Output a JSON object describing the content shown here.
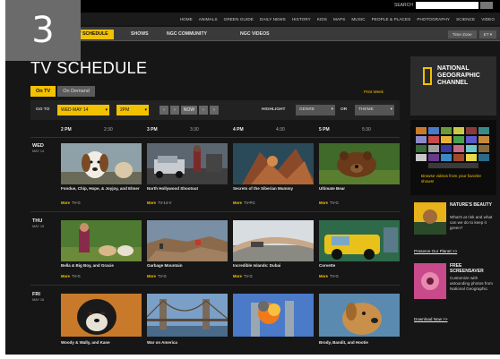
{
  "figure_number": "3",
  "colors": {
    "accent": "#f2c100",
    "background": "#161616"
  },
  "top": {
    "search_label": "SEARCH",
    "nav": [
      "HOME",
      "ANIMALS",
      "GREEN GUIDE",
      "DAILY NEWS",
      "HISTORY",
      "KIDS",
      "MAPS",
      "MUSIC",
      "PEOPLE & PLACES",
      "PHOTOGRAPHY",
      "SCIENCE",
      "VIDEO"
    ]
  },
  "subnav": {
    "tabs": [
      "TV SCHEDULE",
      "SHOWS",
      "NGC COMMUNITY",
      "NGC VIDEOS"
    ],
    "right": [
      "Time Zone",
      "ET ▾"
    ]
  },
  "page_title": "TV SCHEDULE",
  "view_tabs": [
    "On TV",
    "On Demand"
  ],
  "print_link": "Print Week",
  "controls": {
    "go_to": "GO TO",
    "date": "WED MAY 14",
    "time": "2PM",
    "highlight": "HIGHLIGHT",
    "genre": "GENRE",
    "or": "OR",
    "theme": "THEME",
    "now": "NOW",
    "arrow_left": "‹",
    "arrow_right": "›"
  },
  "timeline": [
    "2 PM",
    "2:30",
    "3 PM",
    "3:30",
    "4 PM",
    "4:30",
    "5 PM",
    "5:30"
  ],
  "days": [
    {
      "name": "WED",
      "date": "MAY 14",
      "shows": [
        {
          "title": "Fondue, Chip, Hope, & Joyjoy, and Elmer",
          "rating": "TV-G"
        },
        {
          "title": "North Hollywood Shootout",
          "rating": "TV-14-V"
        },
        {
          "title": "Secrets of the Siberian Mummy",
          "rating": "TV-PG"
        },
        {
          "title": "Ultimate Bear",
          "rating": "TV-G"
        }
      ]
    },
    {
      "name": "THU",
      "date": "MAY 15",
      "shows": [
        {
          "title": "Bella & Big Boy, and Gracie",
          "rating": "TV-G"
        },
        {
          "title": "Garbage Mountain",
          "rating": "TV-G"
        },
        {
          "title": "Incredible Islands: Dubai",
          "rating": "TV-G"
        },
        {
          "title": "Corvette",
          "rating": "TV-G"
        }
      ]
    },
    {
      "name": "FRI",
      "date": "MAY 16",
      "shows": [
        {
          "title": "Woody & Wally, and Kane",
          "rating": ""
        },
        {
          "title": "War on America",
          "rating": ""
        },
        {
          "title": "",
          "rating": ""
        },
        {
          "title": "Brody, Bandit, and Hootie",
          "rating": ""
        }
      ]
    }
  ],
  "more_label": "More",
  "sidebar": {
    "logo": [
      "NATIONAL",
      "GEOGRAPHIC",
      "CHANNEL"
    ],
    "wall_caption": "Browse videos from your favorite shows!",
    "natures_title": "NATURE'S BEAUTY",
    "natures_body": "What's at risk and what can we do to keep it green?",
    "natures_link": "Preserve Our Planet >>",
    "ss_title": "FREE SCREENSAVER",
    "ss_body": "Customize with astounding photos from National Geographic.",
    "ss_link": "Download Now >>"
  }
}
